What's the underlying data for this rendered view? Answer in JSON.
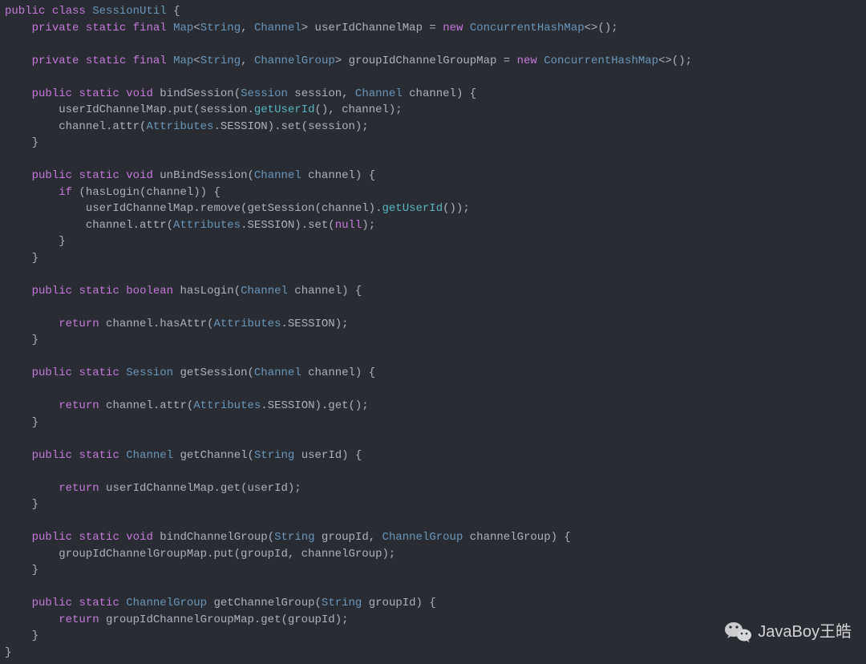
{
  "code": {
    "tokens": [
      [
        [
          "kw",
          "public"
        ],
        [
          "plain",
          " "
        ],
        [
          "kw",
          "class"
        ],
        [
          "plain",
          " "
        ],
        [
          "type",
          "SessionUtil"
        ],
        [
          "plain",
          " {"
        ]
      ],
      [
        [
          "plain",
          "    "
        ],
        [
          "kw",
          "private"
        ],
        [
          "plain",
          " "
        ],
        [
          "kw",
          "static"
        ],
        [
          "plain",
          " "
        ],
        [
          "kw",
          "final"
        ],
        [
          "plain",
          " "
        ],
        [
          "type",
          "Map"
        ],
        [
          "plain",
          "<"
        ],
        [
          "type",
          "String"
        ],
        [
          "plain",
          ", "
        ],
        [
          "type",
          "Channel"
        ],
        [
          "plain",
          "> userIdChannelMap = "
        ],
        [
          "kw",
          "new"
        ],
        [
          "plain",
          " "
        ],
        [
          "type",
          "ConcurrentHashMap"
        ],
        [
          "plain",
          "<>();"
        ]
      ],
      [
        [
          "plain",
          ""
        ]
      ],
      [
        [
          "plain",
          "    "
        ],
        [
          "kw",
          "private"
        ],
        [
          "plain",
          " "
        ],
        [
          "kw",
          "static"
        ],
        [
          "plain",
          " "
        ],
        [
          "kw",
          "final"
        ],
        [
          "plain",
          " "
        ],
        [
          "type",
          "Map"
        ],
        [
          "plain",
          "<"
        ],
        [
          "type",
          "String"
        ],
        [
          "plain",
          ", "
        ],
        [
          "type",
          "ChannelGroup"
        ],
        [
          "plain",
          "> groupIdChannelGroupMap = "
        ],
        [
          "kw",
          "new"
        ],
        [
          "plain",
          " "
        ],
        [
          "type",
          "ConcurrentHashMap"
        ],
        [
          "plain",
          "<>();"
        ]
      ],
      [
        [
          "plain",
          ""
        ]
      ],
      [
        [
          "plain",
          "    "
        ],
        [
          "kw",
          "public"
        ],
        [
          "plain",
          " "
        ],
        [
          "kw",
          "static"
        ],
        [
          "plain",
          " "
        ],
        [
          "kw",
          "void"
        ],
        [
          "plain",
          " bindSession("
        ],
        [
          "type",
          "Session"
        ],
        [
          "plain",
          " session, "
        ],
        [
          "type",
          "Channel"
        ],
        [
          "plain",
          " channel) {"
        ]
      ],
      [
        [
          "plain",
          "        userIdChannelMap.put(session."
        ],
        [
          "method",
          "getUserId"
        ],
        [
          "plain",
          "(), channel);"
        ]
      ],
      [
        [
          "plain",
          "        channel.attr("
        ],
        [
          "type",
          "Attributes"
        ],
        [
          "plain",
          ".SESSION).set(session);"
        ]
      ],
      [
        [
          "plain",
          "    }"
        ]
      ],
      [
        [
          "plain",
          ""
        ]
      ],
      [
        [
          "plain",
          "    "
        ],
        [
          "kw",
          "public"
        ],
        [
          "plain",
          " "
        ],
        [
          "kw",
          "static"
        ],
        [
          "plain",
          " "
        ],
        [
          "kw",
          "void"
        ],
        [
          "plain",
          " unBindSession("
        ],
        [
          "type",
          "Channel"
        ],
        [
          "plain",
          " channel) {"
        ]
      ],
      [
        [
          "plain",
          "        "
        ],
        [
          "kw",
          "if"
        ],
        [
          "plain",
          " (hasLogin(channel)) {"
        ]
      ],
      [
        [
          "plain",
          "            userIdChannelMap.remove(getSession(channel)."
        ],
        [
          "method",
          "getUserId"
        ],
        [
          "plain",
          "());"
        ]
      ],
      [
        [
          "plain",
          "            channel.attr("
        ],
        [
          "type",
          "Attributes"
        ],
        [
          "plain",
          ".SESSION).set("
        ],
        [
          "kw",
          "null"
        ],
        [
          "plain",
          ");"
        ]
      ],
      [
        [
          "plain",
          "        }"
        ]
      ],
      [
        [
          "plain",
          "    }"
        ]
      ],
      [
        [
          "plain",
          ""
        ]
      ],
      [
        [
          "plain",
          "    "
        ],
        [
          "kw",
          "public"
        ],
        [
          "plain",
          " "
        ],
        [
          "kw",
          "static"
        ],
        [
          "plain",
          " "
        ],
        [
          "kw",
          "boolean"
        ],
        [
          "plain",
          " hasLogin("
        ],
        [
          "type",
          "Channel"
        ],
        [
          "plain",
          " channel) {"
        ]
      ],
      [
        [
          "plain",
          ""
        ]
      ],
      [
        [
          "plain",
          "        "
        ],
        [
          "kw",
          "return"
        ],
        [
          "plain",
          " channel.hasAttr("
        ],
        [
          "type",
          "Attributes"
        ],
        [
          "plain",
          ".SESSION);"
        ]
      ],
      [
        [
          "plain",
          "    }"
        ]
      ],
      [
        [
          "plain",
          ""
        ]
      ],
      [
        [
          "plain",
          "    "
        ],
        [
          "kw",
          "public"
        ],
        [
          "plain",
          " "
        ],
        [
          "kw",
          "static"
        ],
        [
          "plain",
          " "
        ],
        [
          "type",
          "Session"
        ],
        [
          "plain",
          " getSession("
        ],
        [
          "type",
          "Channel"
        ],
        [
          "plain",
          " channel) {"
        ]
      ],
      [
        [
          "plain",
          ""
        ]
      ],
      [
        [
          "plain",
          "        "
        ],
        [
          "kw",
          "return"
        ],
        [
          "plain",
          " channel.attr("
        ],
        [
          "type",
          "Attributes"
        ],
        [
          "plain",
          ".SESSION).get();"
        ]
      ],
      [
        [
          "plain",
          "    }"
        ]
      ],
      [
        [
          "plain",
          ""
        ]
      ],
      [
        [
          "plain",
          "    "
        ],
        [
          "kw",
          "public"
        ],
        [
          "plain",
          " "
        ],
        [
          "kw",
          "static"
        ],
        [
          "plain",
          " "
        ],
        [
          "type",
          "Channel"
        ],
        [
          "plain",
          " getChannel("
        ],
        [
          "type",
          "String"
        ],
        [
          "plain",
          " userId) {"
        ]
      ],
      [
        [
          "plain",
          ""
        ]
      ],
      [
        [
          "plain",
          "        "
        ],
        [
          "kw",
          "return"
        ],
        [
          "plain",
          " userIdChannelMap.get(userId);"
        ]
      ],
      [
        [
          "plain",
          "    }"
        ]
      ],
      [
        [
          "plain",
          ""
        ]
      ],
      [
        [
          "plain",
          "    "
        ],
        [
          "kw",
          "public"
        ],
        [
          "plain",
          " "
        ],
        [
          "kw",
          "static"
        ],
        [
          "plain",
          " "
        ],
        [
          "kw",
          "void"
        ],
        [
          "plain",
          " bindChannelGroup("
        ],
        [
          "type",
          "String"
        ],
        [
          "plain",
          " groupId, "
        ],
        [
          "type",
          "ChannelGroup"
        ],
        [
          "plain",
          " channelGroup) {"
        ]
      ],
      [
        [
          "plain",
          "        groupIdChannelGroupMap.put(groupId, channelGroup);"
        ]
      ],
      [
        [
          "plain",
          "    }"
        ]
      ],
      [
        [
          "plain",
          ""
        ]
      ],
      [
        [
          "plain",
          "    "
        ],
        [
          "kw",
          "public"
        ],
        [
          "plain",
          " "
        ],
        [
          "kw",
          "static"
        ],
        [
          "plain",
          " "
        ],
        [
          "type",
          "ChannelGroup"
        ],
        [
          "plain",
          " getChannelGroup("
        ],
        [
          "type",
          "String"
        ],
        [
          "plain",
          " groupId) {"
        ]
      ],
      [
        [
          "plain",
          "        "
        ],
        [
          "kw",
          "return"
        ],
        [
          "plain",
          " groupIdChannelGroupMap.get(groupId);"
        ]
      ],
      [
        [
          "plain",
          "    }"
        ]
      ],
      [
        [
          "plain",
          "}"
        ]
      ]
    ]
  },
  "watermark": {
    "text": "JavaBoy王皓"
  }
}
